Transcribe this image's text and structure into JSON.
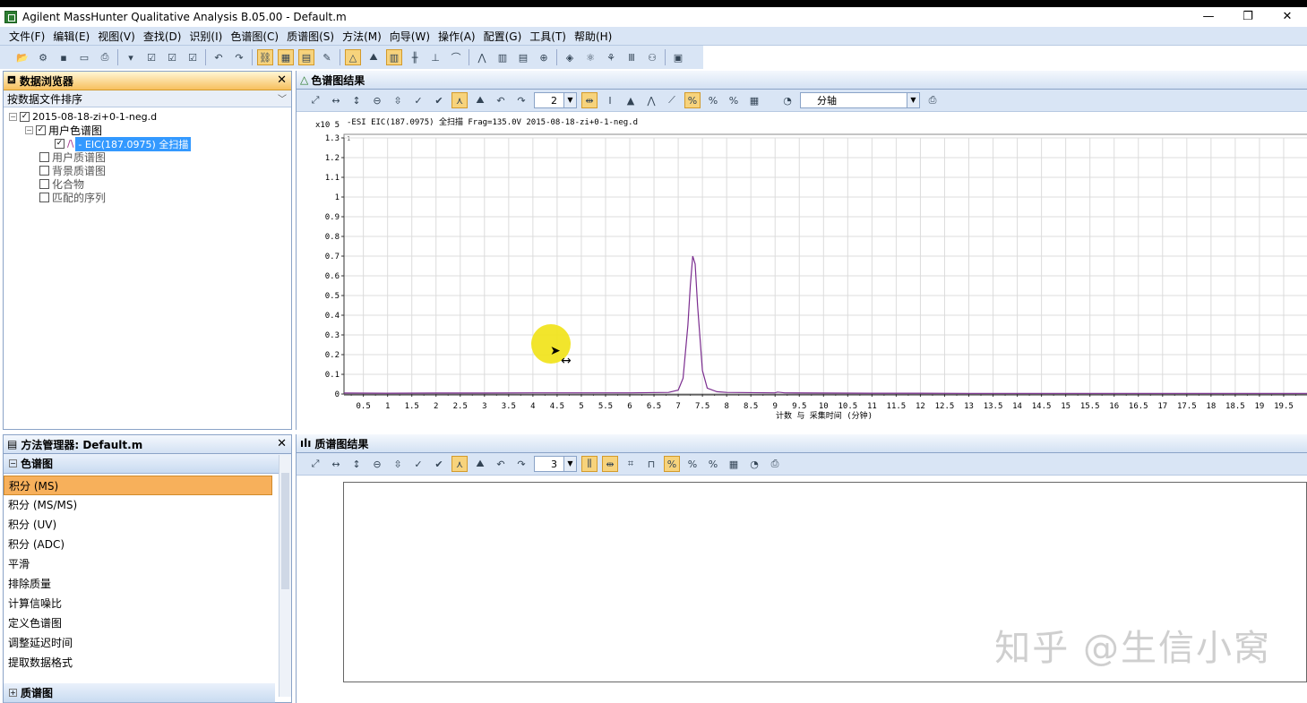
{
  "window": {
    "title": "Agilent MassHunter Qualitative Analysis B.05.00 - Default.m",
    "controls": [
      "—",
      "❐",
      "✕"
    ]
  },
  "menu": [
    "文件(F)",
    "编辑(E)",
    "视图(V)",
    "查找(D)",
    "识别(I)",
    "色谱图(C)",
    "质谱图(S)",
    "方法(M)",
    "向导(W)",
    "操作(A)",
    "配置(G)",
    "工具(T)",
    "帮助(H)"
  ],
  "data_browser": {
    "title": "数据浏览器",
    "close": "✕",
    "sort_label": "按数据文件排序",
    "tree": {
      "file": "2015-08-18-zi+0-1-neg.d",
      "user_chrom": "用户色谱图",
      "eic_item": "- EIC(187.0975) 全扫描",
      "user_spectra": "用户质谱图",
      "bg_spectra": "背景质谱图",
      "compounds": "化合物",
      "matched_seq": "匹配的序列"
    }
  },
  "chrom_results": {
    "title": "色谱图结果",
    "combo_value": "2",
    "axis_combo": "分轴",
    "trace_header": "-ESI EIC(187.0975) 全扫描 Frag=135.0V 2015-08-18-zi+0-1-neg.d",
    "y_multiplier": "x10 5",
    "corner_label": "1",
    "xlabel": "计数 与 采集时间 (分钟)"
  },
  "chart_data": {
    "type": "line",
    "title": "-ESI EIC(187.0975) 全扫描 Frag=135.0V 2015-08-18-zi+0-1-neg.d",
    "xlabel": "计数 与 采集时间 (分钟)",
    "ylabel": "x10 5",
    "xlim": [
      0.1,
      20.0
    ],
    "ylim": [
      0,
      1.3
    ],
    "x_ticks": [
      "0.5",
      "1",
      "1.5",
      "2",
      "2.5",
      "3",
      "3.5",
      "4",
      "4.5",
      "5",
      "5.5",
      "6",
      "6.5",
      "7",
      "7.5",
      "8",
      "8.5",
      "9",
      "9.5",
      "10",
      "10.5",
      "11",
      "11.5",
      "12",
      "12.5",
      "13",
      "13.5",
      "14",
      "14.5",
      "15",
      "15.5",
      "16",
      "16.5",
      "17",
      "17.5",
      "18",
      "18.5",
      "19",
      "19.5"
    ],
    "y_ticks": [
      "0",
      "0.1",
      "0.2",
      "0.3",
      "0.4",
      "0.5",
      "0.6",
      "0.7",
      "0.8",
      "0.9",
      "1",
      "1.1",
      "1.2",
      "1.3"
    ],
    "grid": true,
    "series": [
      {
        "color": "#7b2d8f",
        "x": [
          0.1,
          1,
          2,
          3,
          4,
          5,
          6,
          6.8,
          7.0,
          7.1,
          7.2,
          7.25,
          7.3,
          7.35,
          7.4,
          7.5,
          7.6,
          7.8,
          8,
          9,
          9.05,
          9.2,
          10,
          11,
          12,
          13,
          14,
          15,
          16,
          17,
          18,
          19,
          20
        ],
        "y": [
          0.005,
          0.004,
          0.005,
          0.005,
          0.006,
          0.006,
          0.006,
          0.008,
          0.02,
          0.08,
          0.35,
          0.55,
          0.7,
          0.66,
          0.45,
          0.12,
          0.03,
          0.012,
          0.008,
          0.006,
          0.01,
          0.006,
          0.005,
          0.004,
          0.004,
          0.003,
          0.003,
          0.003,
          0.003,
          0.003,
          0.003,
          0.003,
          0.003
        ]
      }
    ]
  },
  "method_manager": {
    "title": "方法管理器: Default.m",
    "close": "✕",
    "section_chrom": "色谱图",
    "items": [
      "积分 (MS)",
      "积分 (MS/MS)",
      "积分 (UV)",
      "积分 (ADC)",
      "平滑",
      "排除质量",
      "计算信噪比",
      "定义色谱图",
      "调整延迟时间",
      "提取数据格式"
    ],
    "section_spec": "质谱图"
  },
  "spec_results": {
    "title": "质谱图结果",
    "combo_value": "3"
  },
  "watermark": "知乎 @生信小窝"
}
